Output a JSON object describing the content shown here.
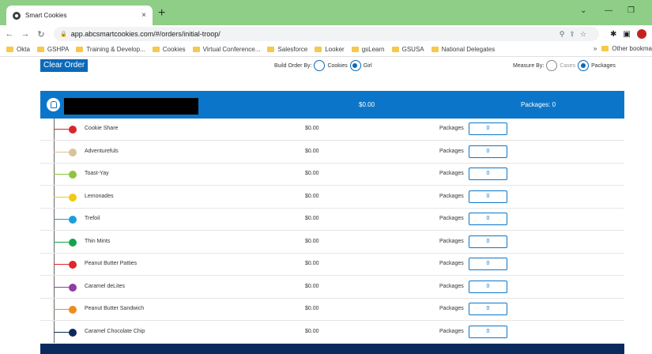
{
  "browser": {
    "tab_title": "Smart Cookies",
    "tab_close": "×",
    "new_tab": "+",
    "url": "app.abcsmartcookies.com/#/orders/initial-troop/",
    "bookmarks": [
      "Okta",
      "GSHPA",
      "Training & Develop...",
      "Cookies",
      "Virtual Conference...",
      "Salesforce",
      "Looker",
      "gsLearn",
      "GSUSA",
      "National Delegates"
    ],
    "bookmarks_more": "»",
    "other_bookmarks": "Other bookma"
  },
  "toolbar": {
    "clear_order_label": "Clear Order",
    "build_order_by_label": "Build Order By:",
    "build_option_cookies": "Cookies",
    "build_option_girl": "Girl",
    "measure_by_label": "Measure By:",
    "measure_option_cases": "Cases",
    "measure_option_packages": "Packages"
  },
  "troop": {
    "total": "$0.00",
    "packages": "Packages: 0",
    "collapse_icon": "chevron-up-icon"
  },
  "cookies": [
    {
      "name": "Cookie Share",
      "price": "$0.00",
      "label": "Packages",
      "qty": "0",
      "color": "#d9262b"
    },
    {
      "name": "Adventurefuls",
      "price": "$0.00",
      "label": "Packages",
      "qty": "0",
      "color": "#d8c49a"
    },
    {
      "name": "Toast-Yay",
      "price": "$0.00",
      "label": "Packages",
      "qty": "0",
      "color": "#8dc63f"
    },
    {
      "name": "Lemonades",
      "price": "$0.00",
      "label": "Packages",
      "qty": "0",
      "color": "#f2c90f"
    },
    {
      "name": "Trefoil",
      "price": "$0.00",
      "label": "Packages",
      "qty": "0",
      "color": "#1b9ed8"
    },
    {
      "name": "Thin Mints",
      "price": "$0.00",
      "label": "Packages",
      "qty": "0",
      "color": "#14a34a"
    },
    {
      "name": "Peanut Butter Patties",
      "price": "$0.00",
      "label": "Packages",
      "qty": "0",
      "color": "#e0262b"
    },
    {
      "name": "Caramel deLites",
      "price": "$0.00",
      "label": "Packages",
      "qty": "0",
      "color": "#8e3fa0"
    },
    {
      "name": "Peanut Butter Sandwich",
      "price": "$0.00",
      "label": "Packages",
      "qty": "0",
      "color": "#ef8c1d"
    },
    {
      "name": "Caramel Chocolate Chip",
      "price": "$0.00",
      "label": "Packages",
      "qty": "0",
      "color": "#0b2b5e"
    }
  ]
}
